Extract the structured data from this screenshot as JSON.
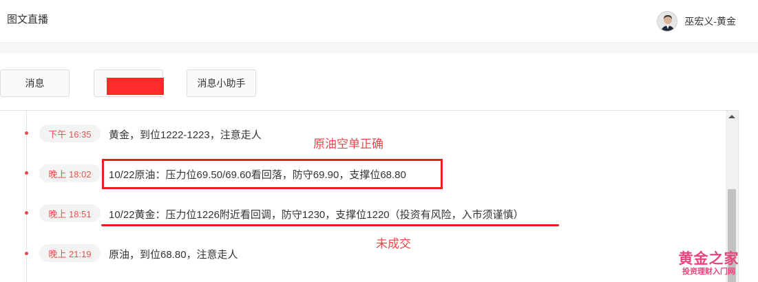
{
  "header": {
    "app_title": "图文直播",
    "user_name": "巫宏义-黄金"
  },
  "tabs": [
    {
      "label": "消息"
    },
    {
      "label": ""
    },
    {
      "label": "消息小助手"
    }
  ],
  "feed": [
    {
      "time": "下午 16:35",
      "text": "黄金，到位1222-1223，注意走人"
    },
    {
      "time": "晚上 18:02",
      "text": "10/22原油：压力位69.50/69.60看回落，防守69.90，支撑位68.80"
    },
    {
      "time": "晚上 18:51",
      "text": "10/22黄金：压力位1226附近看回调，防守1230，支撑位1220（投资有风险，入市须谨慎）"
    },
    {
      "time": "晚上 21:19",
      "text": "原油，到位68.80，注意走人"
    }
  ],
  "annotations": {
    "oil_note": "原油空单正确",
    "gold_note": "未成交"
  },
  "watermark": {
    "big": "黄金之家",
    "small": "投资理财入门网"
  },
  "colors": {
    "accent_red": "#e8484a",
    "annotation_red": "#e82020",
    "watermark_pink": "#e9457a"
  }
}
